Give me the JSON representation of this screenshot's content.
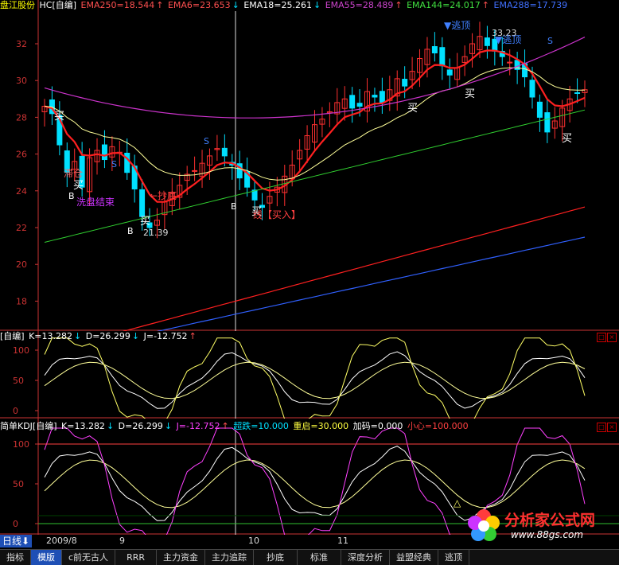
{
  "main_header": {
    "stock": "盘江股份",
    "formula": "HC[自编]",
    "ema250": "EMA250=18.544",
    "ema6": "EMA6=23.653",
    "ema18": "EMA18=25.261",
    "ema55": "EMA55=28.489",
    "ema144": "EMA144=24.017",
    "ema288": "EMA288=17.739",
    "arrow_up": "↑",
    "arrow_down": "↓"
  },
  "colors": {
    "up": "#ff3030",
    "down": "#00e0ff",
    "ema250": "#ff3030",
    "ema6": "#ff3030",
    "ema18": "#ffffff",
    "ema55": "#cc33cc",
    "ema144": "#30d030",
    "ema288": "#3060ff",
    "yellow": "#ffff80"
  },
  "main_yaxis": [
    "32",
    "30",
    "28",
    "26",
    "24",
    "22",
    "20",
    "18"
  ],
  "annotations": {
    "buy": "买",
    "sell": "S",
    "b": "B",
    "hedge": "滞仓",
    "wash": "洗盘结束",
    "bottom": "抄底",
    "line_buy": "线【买入】",
    "low_price": "21.39",
    "high_price": "33.23",
    "escape": "逃顶",
    "escape2": "逃顶"
  },
  "kdj1_header": {
    "title": "[自编]",
    "k": "K=13.282",
    "d": "D=26.299",
    "j": "J=-12.752"
  },
  "kdj1_yaxis": [
    "100",
    "50",
    "0"
  ],
  "kdj2_header": {
    "title": "简单KDJ[自编]",
    "k": "K=13.282",
    "d": "D=26.299",
    "j": "J=-12.752",
    "chaodie": "超跌=10.000",
    "chongqi": "重启=30.000",
    "jiama": "加码=0.000",
    "xiaoxin": "小心=100.000"
  },
  "kdj2_yaxis": [
    "100",
    "50",
    "0"
  ],
  "xaxis": {
    "day_label": "日线",
    "year_month": "2009/8",
    "m9": "9",
    "m10": "10",
    "m11": "11"
  },
  "tabs": [
    "指标",
    "模版",
    "c前无古人",
    "RRR",
    "主力资金",
    "主力追踪",
    "抄底",
    "标准",
    "深度分析",
    "益盟经典",
    "逃顶"
  ],
  "logo": {
    "title": "分析家公式网",
    "url": "www.88gs.com"
  }
}
